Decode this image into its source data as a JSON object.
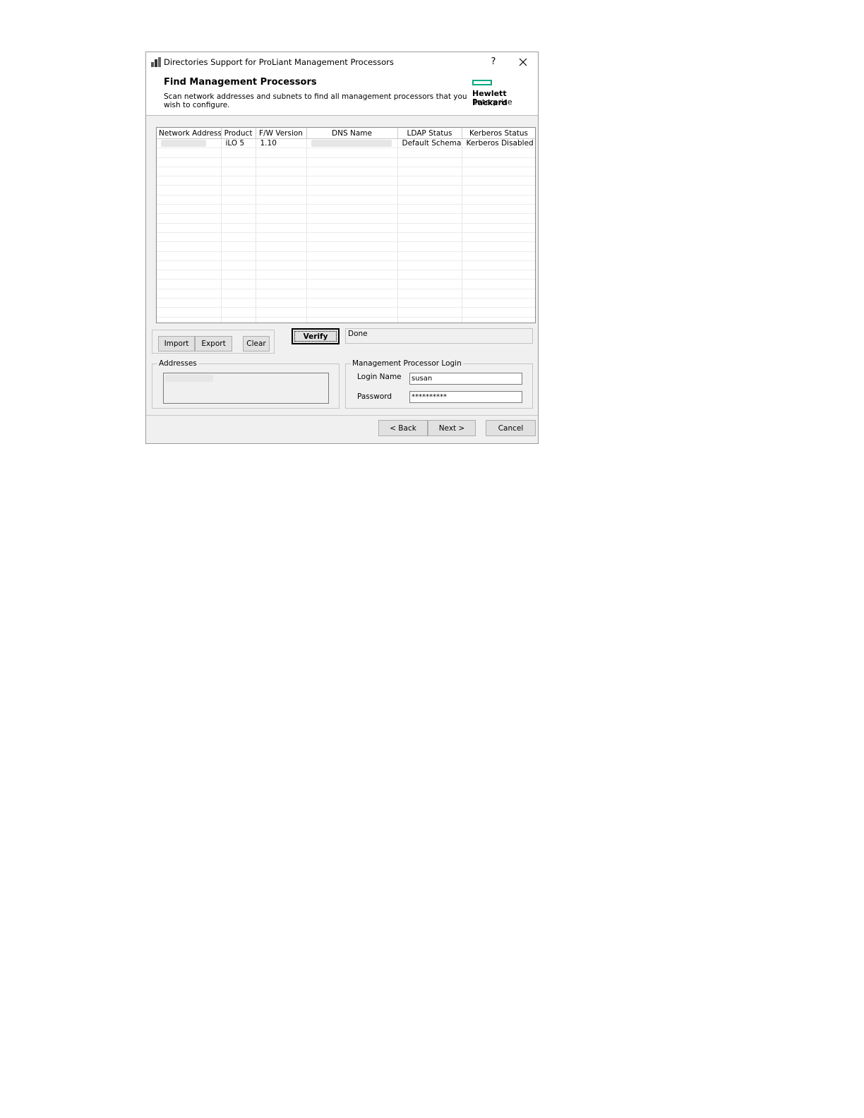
{
  "window": {
    "title": "Directories Support for ProLiant Management Processors",
    "help_label": "?"
  },
  "header": {
    "title": "Find Management Processors",
    "subtitle": "Scan network addresses and subnets to find all management processors that you wish to configure.",
    "logo_line1": "Hewlett Packard",
    "logo_line2": "Enterprise",
    "logo_color": "#01a982"
  },
  "grid": {
    "columns": [
      "Network Address",
      "Product",
      "F/W Version",
      "DNS Name",
      "LDAP Status",
      "Kerberos Status"
    ],
    "rows": [
      {
        "network_address": "",
        "product": "iLO 5",
        "fw_version": "1.10",
        "dns_name": "",
        "ldap_status": "Default Schema",
        "kerberos_status": "Kerberos Disabled"
      }
    ]
  },
  "buttons": {
    "import": "Import",
    "export": "Export",
    "clear": "Clear",
    "verify": "Verify"
  },
  "status_text": "Done",
  "addresses": {
    "label": "Addresses"
  },
  "login": {
    "group_label": "Management Processor Login",
    "login_name_label": "Login Name",
    "login_name_value": "susan",
    "password_label": "Password",
    "password_value": "**********"
  },
  "footer": {
    "back": "< Back",
    "next": "Next >",
    "cancel": "Cancel"
  }
}
